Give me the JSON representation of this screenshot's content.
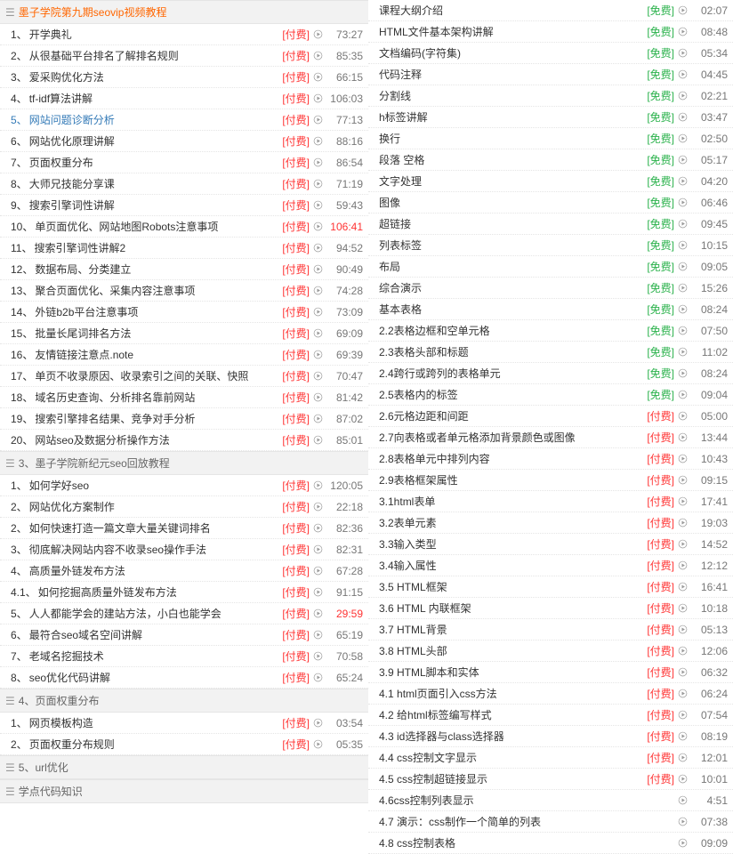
{
  "left_sections": [
    {
      "title": "墨子学院第九期seovip视频教程",
      "orange": true,
      "items": [
        {
          "n": "1、",
          "t": "开学典礼",
          "tag": "[付费]",
          "dur": "73:27"
        },
        {
          "n": "2、",
          "t": "从很基础平台排名了解排名规则",
          "tag": "[付费]",
          "dur": "85:35"
        },
        {
          "n": "3、",
          "t": "爱采购优化方法",
          "tag": "[付费]",
          "dur": "66:15"
        },
        {
          "n": "4、",
          "t": "tf-idf算法讲解",
          "tag": "[付费]",
          "dur": "106:03"
        },
        {
          "n": "5、",
          "t": "网站问题诊断分析",
          "tag": "[付费]",
          "dur": "77:13",
          "link": true
        },
        {
          "n": "6、",
          "t": "网站优化原理讲解",
          "tag": "[付费]",
          "dur": "88:16"
        },
        {
          "n": "7、",
          "t": "页面权重分布",
          "tag": "[付费]",
          "dur": "86:54"
        },
        {
          "n": "8、",
          "t": "大师兄技能分享课",
          "tag": "[付费]",
          "dur": "71:19"
        },
        {
          "n": "9、",
          "t": "搜索引擎词性讲解",
          "tag": "[付费]",
          "dur": "59:43"
        },
        {
          "n": "10、",
          "t": "单页面优化、网站地图Robots注意事项",
          "tag": "[付费]",
          "dur": "106:41",
          "durRed": true
        },
        {
          "n": "11、",
          "t": "搜索引擎词性讲解2",
          "tag": "[付费]",
          "dur": "94:52"
        },
        {
          "n": "12、",
          "t": "数据布局、分类建立",
          "tag": "[付费]",
          "dur": "90:49"
        },
        {
          "n": "13、",
          "t": "聚合页面优化、采集内容注意事项",
          "tag": "[付费]",
          "dur": "74:28"
        },
        {
          "n": "14、",
          "t": "外链b2b平台注意事项",
          "tag": "[付费]",
          "dur": "73:09"
        },
        {
          "n": "15、",
          "t": "批量长尾词排名方法",
          "tag": "[付费]",
          "dur": "69:09"
        },
        {
          "n": "16、",
          "t": "友情链接注意点.note",
          "tag": "[付费]",
          "dur": "69:39"
        },
        {
          "n": "17、",
          "t": "单页不收录原因、收录索引之间的关联、快照",
          "tag": "[付费]",
          "dur": "70:47"
        },
        {
          "n": "18、",
          "t": "域名历史查询、分析排名靠前网站",
          "tag": "[付费]",
          "dur": "81:42"
        },
        {
          "n": "19、",
          "t": "搜索引擎排名结果、竞争对手分析",
          "tag": "[付费]",
          "dur": "87:02"
        },
        {
          "n": "20、",
          "t": "网站seo及数据分析操作方法",
          "tag": "[付费]",
          "dur": "85:01"
        }
      ]
    },
    {
      "title": "3、墨子学院新纪元seo回放教程",
      "items": [
        {
          "n": "1、",
          "t": "如何学好seo",
          "tag": "[付费]",
          "dur": "120:05"
        },
        {
          "n": "2、",
          "t": "网站优化方案制作",
          "tag": "[付费]",
          "dur": "22:18"
        },
        {
          "n": "2、",
          "t": "如何快速打造一篇文章大量关键词排名",
          "tag": "[付费]",
          "dur": "82:36"
        },
        {
          "n": "3、",
          "t": "彻底解决网站内容不收录seo操作手法",
          "tag": "[付费]",
          "dur": "82:31"
        },
        {
          "n": "4、",
          "t": "高质量外链发布方法",
          "tag": "[付费]",
          "dur": "67:28"
        },
        {
          "n": "4.1、",
          "t": "如何挖掘高质量外链发布方法",
          "tag": "[付费]",
          "dur": "91:15"
        },
        {
          "n": "5、",
          "t": "人人都能学会的建站方法，小白也能学会",
          "tag": "[付费]",
          "dur": "29:59",
          "durRed": true
        },
        {
          "n": "6、",
          "t": "最符合seo域名空间讲解",
          "tag": "[付费]",
          "dur": "65:19"
        },
        {
          "n": "7、",
          "t": "老域名挖掘技术",
          "tag": "[付费]",
          "dur": "70:58"
        },
        {
          "n": "8、",
          "t": "seo优化代码讲解",
          "tag": "[付费]",
          "dur": "65:24"
        }
      ]
    },
    {
      "title": "4、页面权重分布",
      "items": [
        {
          "n": "1、",
          "t": "网页模板构造",
          "tag": "[付费]",
          "dur": "03:54"
        },
        {
          "n": "2、",
          "t": "页面权重分布规则",
          "tag": "[付费]",
          "dur": "05:35"
        }
      ]
    },
    {
      "title": "5、url优化",
      "items": []
    },
    {
      "title": "学点代码知识",
      "items": []
    }
  ],
  "right_items": [
    {
      "t": "课程大纲介绍",
      "tag": "[免费]",
      "green": true,
      "dur": "02:07"
    },
    {
      "t": "HTML文件基本架构讲解",
      "tag": "[免费]",
      "green": true,
      "dur": "08:48"
    },
    {
      "t": "文档编码(字符集)",
      "tag": "[免费]",
      "green": true,
      "dur": "05:34"
    },
    {
      "t": "代码注释",
      "tag": "[免费]",
      "green": true,
      "dur": "04:45"
    },
    {
      "t": "分割线",
      "tag": "[免费]",
      "green": true,
      "dur": "02:21"
    },
    {
      "t": "h标签讲解",
      "tag": "[免费]",
      "green": true,
      "dur": "03:47"
    },
    {
      "t": "换行",
      "tag": "[免费]",
      "green": true,
      "dur": "02:50"
    },
    {
      "t": "段落 空格",
      "tag": "[免费]",
      "green": true,
      "dur": "05:17"
    },
    {
      "t": "文字处理",
      "tag": "[免费]",
      "green": true,
      "dur": "04:20"
    },
    {
      "t": "图像",
      "tag": "[免费]",
      "green": true,
      "dur": "06:46"
    },
    {
      "t": "超链接",
      "tag": "[免费]",
      "green": true,
      "dur": "09:45"
    },
    {
      "t": "列表标签",
      "tag": "[免费]",
      "green": true,
      "dur": "10:15"
    },
    {
      "t": "布局",
      "tag": "[免费]",
      "green": true,
      "dur": "09:05"
    },
    {
      "t": "综合演示",
      "tag": "[免费]",
      "green": true,
      "dur": "15:26"
    },
    {
      "t": "基本表格",
      "tag": "[免费]",
      "green": true,
      "dur": "08:24"
    },
    {
      "t": "2.2表格边框和空单元格",
      "tag": "[免费]",
      "green": true,
      "dur": "07:50"
    },
    {
      "t": "2.3表格头部和标题",
      "tag": "[免费]",
      "green": true,
      "dur": "11:02"
    },
    {
      "t": "2.4跨行或跨列的表格单元",
      "tag": "[免费]",
      "green": true,
      "dur": "08:24"
    },
    {
      "t": "2.5表格内的标签",
      "tag": "[免费]",
      "green": true,
      "dur": "09:04"
    },
    {
      "t": "2.6元格边距和间距",
      "tag": "[付费]",
      "dur": "05:00"
    },
    {
      "t": "2.7向表格或者单元格添加背景颜色或图像",
      "tag": "[付费]",
      "dur": "13:44"
    },
    {
      "t": "2.8表格单元中排列内容",
      "tag": "[付费]",
      "dur": "10:43"
    },
    {
      "t": "2.9表格框架属性",
      "tag": "[付费]",
      "dur": "09:15"
    },
    {
      "t": "3.1html表单",
      "tag": "[付费]",
      "dur": "17:41"
    },
    {
      "t": "3.2表单元素",
      "tag": "[付费]",
      "dur": "19:03"
    },
    {
      "t": "3.3输入类型",
      "tag": "[付费]",
      "dur": "14:52"
    },
    {
      "t": "3.4输入属性",
      "tag": "[付费]",
      "dur": "12:12"
    },
    {
      "t": "3.5 HTML框架",
      "tag": "[付费]",
      "dur": "16:41"
    },
    {
      "t": "3.6 HTML 内联框架",
      "tag": "[付费]",
      "dur": "10:18"
    },
    {
      "t": "3.7 HTML背景",
      "tag": "[付费]",
      "dur": "05:13"
    },
    {
      "t": "3.8 HTML头部",
      "tag": "[付费]",
      "dur": "12:06"
    },
    {
      "t": "3.9 HTML脚本和实体",
      "tag": "[付费]",
      "dur": "06:32"
    },
    {
      "t": "4.1 html页面引入css方法",
      "tag": "[付费]",
      "dur": "06:24"
    },
    {
      "t": "4.2 给html标签编写样式",
      "tag": "[付费]",
      "dur": "07:54"
    },
    {
      "t": "4.3 id选择器与class选择器",
      "tag": "[付费]",
      "dur": "08:19"
    },
    {
      "t": "4.4 css控制文字显示",
      "tag": "[付费]",
      "dur": "12:01"
    },
    {
      "t": "4.5 css控制超链接显示",
      "tag": "[付费]",
      "dur": "10:01"
    },
    {
      "t": "4.6css控制列表显示",
      "tag": "",
      "dur": "4:51"
    },
    {
      "t": "4.7 演示：css制作一个简单的列表",
      "tag": "",
      "dur": "07:38"
    },
    {
      "t": "4.8 css控制表格",
      "tag": "",
      "dur": "09:09"
    }
  ]
}
